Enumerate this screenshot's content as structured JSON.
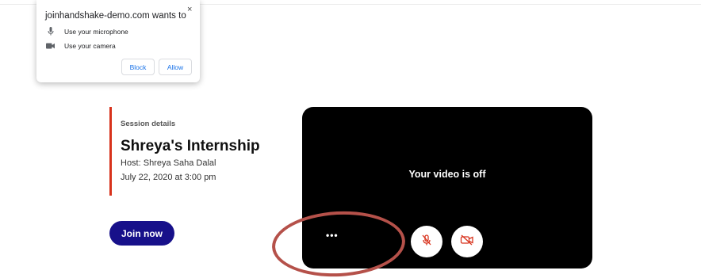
{
  "permission_prompt": {
    "title": "joinhandshake-demo.com wants to",
    "close_glyph": "×",
    "items": [
      {
        "icon": "microphone-icon",
        "label": "Use your microphone"
      },
      {
        "icon": "camera-icon",
        "label": "Use your camera"
      }
    ],
    "block_label": "Block",
    "allow_label": "Allow"
  },
  "session": {
    "label": "Session details",
    "title": "Shreya's Internship",
    "host": "Host: Shreya Saha Dalal",
    "date": "July 22, 2020 at 3:00 pm",
    "join_label": "Join now"
  },
  "video": {
    "status": "Your video is off",
    "more_glyph": "•••",
    "mic_icon": "microphone-muted-icon",
    "cam_icon": "camera-off-icon"
  },
  "colors": {
    "accent": "#d8321c",
    "join_button": "#17108a",
    "video_bg": "#000000",
    "control_icon": "#d8321c",
    "link_blue": "#1a73e8",
    "annotation": "#b5514a"
  }
}
